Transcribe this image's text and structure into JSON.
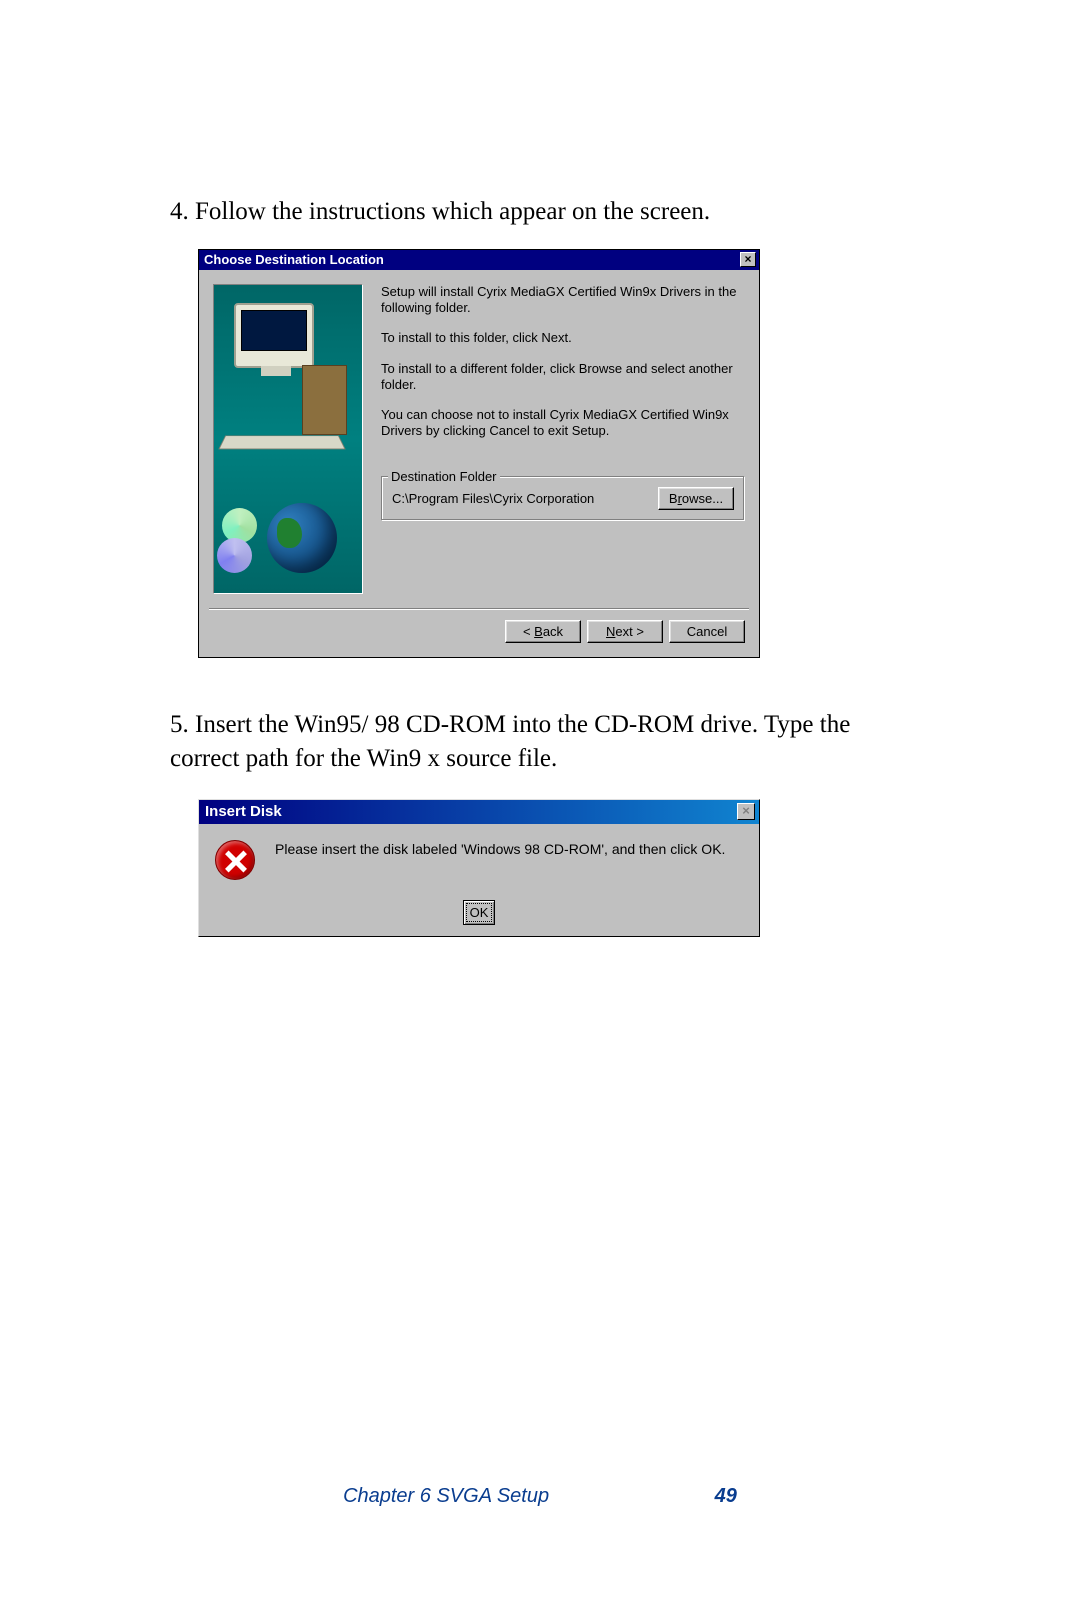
{
  "step4": "4. Follow the instructions which appear on the screen.",
  "step5": "5. Insert the Win95/ 98 CD-ROM into the CD-ROM drive. Type the correct path for the Win9 x source file.",
  "dialog1": {
    "title": "Choose Destination Location",
    "close_x": "×",
    "para1": "Setup will install Cyrix MediaGX Certified Win9x Drivers in the following folder.",
    "para2": "To install to this folder, click Next.",
    "para3": "To install to a different folder, click Browse and select another folder.",
    "para4": "You can choose not to install Cyrix MediaGX Certified Win9x Drivers by clicking Cancel to exit Setup.",
    "dest_label": "Destination Folder",
    "dest_path": "C:\\Program Files\\Cyrix Corporation",
    "browse_pre": "B",
    "browse_ul": "r",
    "browse_post": "owse...",
    "back_pre": "< ",
    "back_ul": "B",
    "back_post": "ack",
    "next_ul": "N",
    "next_post": "ext >",
    "cancel": "Cancel"
  },
  "dialog2": {
    "title": "Insert Disk",
    "close_x": "×",
    "message": "Please insert the disk labeled 'Windows 98 CD-ROM', and then click OK.",
    "ok": "OK"
  },
  "footer": {
    "chapter": "Chapter 6   SVGA Setup",
    "page": "49"
  }
}
